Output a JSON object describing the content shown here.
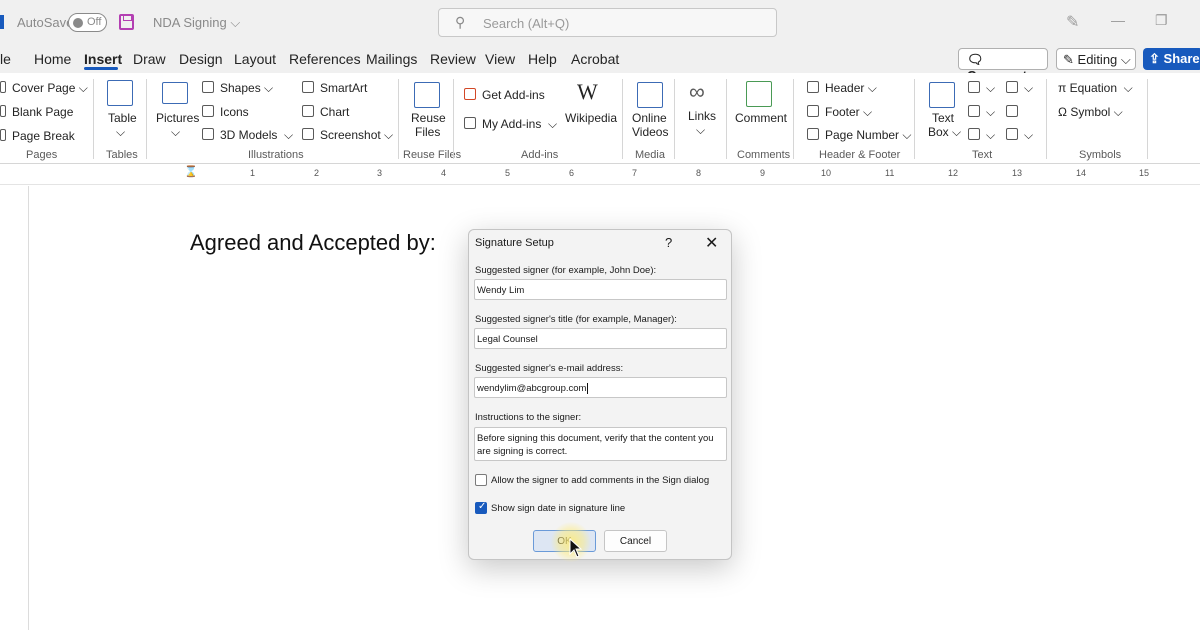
{
  "titlebar": {
    "autosave_label": "AutoSave",
    "autosave_state": "Off",
    "doc_name": "NDA Signing",
    "search_placeholder": "Search (Alt+Q)"
  },
  "menu": {
    "tabs": [
      "le",
      "Home",
      "Insert",
      "Draw",
      "Design",
      "Layout",
      "References",
      "Mailings",
      "Review",
      "View",
      "Help",
      "Acrobat"
    ],
    "active_tab": "Insert",
    "comments_label": "Comments",
    "editing_label": "Editing",
    "share_label": "Share"
  },
  "ribbon": {
    "pages": {
      "items": [
        "Cover Page",
        "Blank Page",
        "Page Break"
      ],
      "group": "Pages"
    },
    "tables": {
      "label": "Table",
      "group": "Tables"
    },
    "illustrations": {
      "pictures": "Pictures",
      "items": [
        "Shapes",
        "Icons",
        "3D Models",
        "SmartArt",
        "Chart",
        "Screenshot"
      ],
      "group": "Illustrations"
    },
    "reuse": {
      "label1": "Reuse",
      "label2": "Files",
      "group": "Reuse Files"
    },
    "addins": {
      "get": "Get Add-ins",
      "my": "My Add-ins",
      "wikipedia": "Wikipedia",
      "group": "Add-ins"
    },
    "media": {
      "label1": "Online",
      "label2": "Videos",
      "group": "Media"
    },
    "links": {
      "label": "Links"
    },
    "comments": {
      "label": "Comment",
      "group": "Comments"
    },
    "header_footer": {
      "items": [
        "Header",
        "Footer",
        "Page Number"
      ],
      "group": "Header & Footer"
    },
    "text": {
      "label1": "Text",
      "label2": "Box",
      "group": "Text"
    },
    "symbols": {
      "equation": "Equation",
      "symbol": "Symbol",
      "group": "Symbols"
    }
  },
  "ruler": {
    "numbers": [
      "1",
      "2",
      "3",
      "4",
      "5",
      "6",
      "7",
      "8",
      "9",
      "10",
      "11",
      "12",
      "13",
      "14",
      "15"
    ]
  },
  "document": {
    "text": "Agreed and Accepted by:"
  },
  "dialog": {
    "title": "Signature Setup",
    "help": "?",
    "close": "✕",
    "signer_label": "Suggested signer (for example, John Doe):",
    "signer_value": "Wendy Lim",
    "title_label": "Suggested signer's title (for example, Manager):",
    "title_value": "Legal Counsel",
    "email_label": "Suggested signer's e-mail address:",
    "email_value": "wendylim@abcgroup.com",
    "instructions_label": "Instructions to the signer:",
    "instructions_value": "Before signing this document, verify that the content you are signing is correct.",
    "allow_comments_label": "Allow the signer to add comments in the Sign dialog",
    "allow_comments_checked": false,
    "show_date_label": "Show sign date in signature line",
    "show_date_checked": true,
    "ok_label": "OK",
    "cancel_label": "Cancel"
  },
  "colors": {
    "accent": "#185abd",
    "save_icon": "#b33fb2"
  }
}
